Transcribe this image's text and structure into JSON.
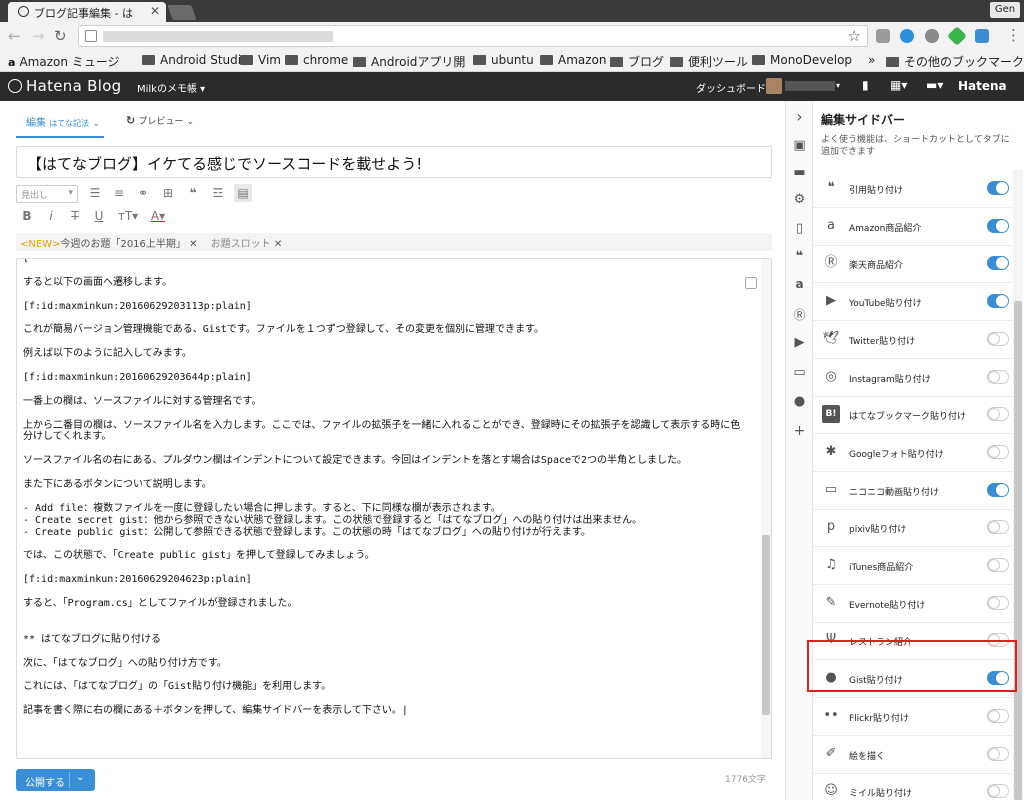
{
  "browser": {
    "tab_title": "ブログ記事編集 - は",
    "profile_label": "Gen",
    "bookmarks": [
      "Amazon ミュージ",
      "Android Studio",
      "Vim",
      "chrome",
      "Androidアプリ開",
      "ubuntu",
      "Amazon",
      "ブログ",
      "便利ツール",
      "MonoDevelop",
      "その他のブックマーク"
    ],
    "overflow": "»"
  },
  "header": {
    "logo": "Hatena Blog",
    "blog_name": "Milkのメモ帳 ▾",
    "dashboard": "ダッシュボード",
    "brand": "Hatena"
  },
  "editor": {
    "tab_edit": "編集",
    "tab_edit_sub": "はてな記法",
    "tab_preview": "プレビュー",
    "title": "【はてなブログ】イケてる感じでソースコードを載せよう!",
    "heading_select": "見出し",
    "topics_new": "<NEW>",
    "topic_1": "今週のお題「2016上半期」",
    "topic_2": "お題スロット",
    "body_lines": [
      "[",
      "",
      "すると以下の画面へ遷移します。",
      "",
      "[f:id:maxminkun:20160629203113p:plain]",
      "",
      "これが簡易バージョン管理機能である、Gistです。ファイルを１つずつ登録して、その変更を個別に管理できます。",
      "",
      "例えば以下のように記入してみます。",
      "",
      "[f:id:maxminkun:20160629203644p:plain]",
      "",
      "一番上の欄は、ソースファイルに対する管理名です。",
      "",
      "上から二番目の欄は、ソースファイル名を入力します。ここでは、ファイルの拡張子を一緒に入れることができ、登録時にその拡張子を認識して表示する時に色分けしてくれます。",
      "",
      "ソースファイル名の右にある、プルダウン欄はインデントについて設定できます。今回はインデントを落とす場合はSpaceで2つの半角としました。",
      "",
      "また下にあるボタンについて説明します。",
      "",
      "- Add file：複数ファイルを一度に登録したい場合に押します。すると、下に同様な欄が表示されます。",
      "- Create secret gist：他から参照できない状態で登録します。この状態で登録すると「はてなブログ」への貼り付けは出来ません。",
      "- Create public gist：公開して参照できる状態で登録します。この状態の時「はてなブログ」への貼り付けが行えます。",
      "",
      "では、この状態で、「Create public gist」を押して登録してみましょう。",
      "",
      "[f:id:maxminkun:20160629204623p:plain]",
      "",
      "すると、「Program.cs」としてファイルが登録されました。",
      "",
      "",
      "** はてなブログに貼り付ける",
      "",
      "次に、「はてなブログ」への貼り付け方です。",
      "",
      "これには、「はてなブログ」の「Gist貼り付け機能」を利用します。",
      "",
      "記事を書く際に右の欄にある＋ボタンを押して、編集サイドバーを表示して下さい。|"
    ],
    "publish_label": "公開する",
    "char_count": "1776文字"
  },
  "sidebar": {
    "title": "編集サイドバー",
    "description": "よく使う機能は、ショートカットとしてタブに追加できます",
    "items": [
      {
        "label": "引用貼り付け",
        "icon": "quote-icon",
        "enabled": true
      },
      {
        "label": "Amazon商品紹介",
        "icon": "amazon-icon",
        "enabled": true
      },
      {
        "label": "楽天商品紹介",
        "icon": "rakuten-icon",
        "enabled": true
      },
      {
        "label": "YouTube貼り付け",
        "icon": "youtube-icon",
        "enabled": true
      },
      {
        "label": "Twitter貼り付け",
        "icon": "twitter-icon",
        "enabled": false
      },
      {
        "label": "Instagram貼り付け",
        "icon": "instagram-icon",
        "enabled": false
      },
      {
        "label": "はてなブックマーク貼り付け",
        "icon": "hatena-bookmark-icon",
        "enabled": false
      },
      {
        "label": "Googleフォト貼り付け",
        "icon": "google-photos-icon",
        "enabled": false
      },
      {
        "label": "ニコニコ動画貼り付け",
        "icon": "niconico-icon",
        "enabled": true
      },
      {
        "label": "pixiv貼り付け",
        "icon": "pixiv-icon",
        "enabled": false
      },
      {
        "label": "iTunes商品紹介",
        "icon": "itunes-icon",
        "enabled": false
      },
      {
        "label": "Evernote貼り付け",
        "icon": "evernote-icon",
        "enabled": false
      },
      {
        "label": "レストラン紹介",
        "icon": "restaurant-icon",
        "enabled": false
      },
      {
        "label": "Gist貼り付け",
        "icon": "github-icon",
        "enabled": true
      },
      {
        "label": "Flickr貼り付け",
        "icon": "flickr-icon",
        "enabled": false
      },
      {
        "label": "絵を描く",
        "icon": "brush-icon",
        "enabled": false
      },
      {
        "label": "ミイル貼り付け",
        "icon": "miil-icon",
        "enabled": false
      }
    ]
  },
  "colors": {
    "accent": "#3a8ed6",
    "highlight": "#e02020",
    "header_bg": "#2b2b2b"
  }
}
